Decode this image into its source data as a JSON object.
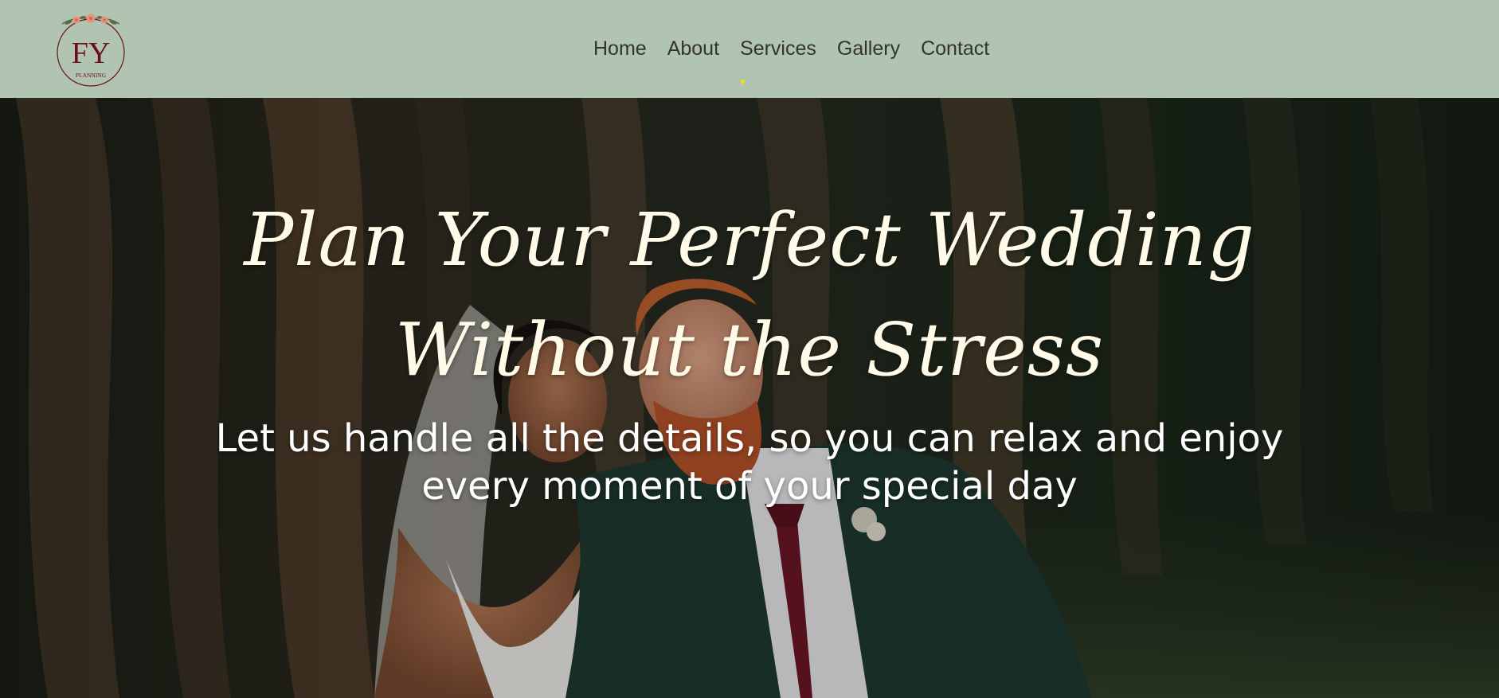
{
  "colors": {
    "header_bg": "#b1c3b1",
    "nav_text": "#333333",
    "active_indicator": "#f2e600",
    "hero_text": "#fffbe8",
    "logo_text": "#6b0f1a",
    "logo_flowers": "#e8907a",
    "logo_leaves": "#5c6a4a"
  },
  "logo": {
    "monogram": "FY",
    "caption": "PLANNING"
  },
  "nav": {
    "items": [
      {
        "label": "Home"
      },
      {
        "label": "About"
      },
      {
        "label": "Services"
      },
      {
        "label": "Gallery"
      },
      {
        "label": "Contact"
      }
    ]
  },
  "hero": {
    "title_line_1": "Plan Your Perfect Wedding",
    "title_line_2": "Without the Stress",
    "subtitle_line_1": "Let us handle all the details, so you can relax and enjoy",
    "subtitle_line_2": "every moment of your special day"
  }
}
